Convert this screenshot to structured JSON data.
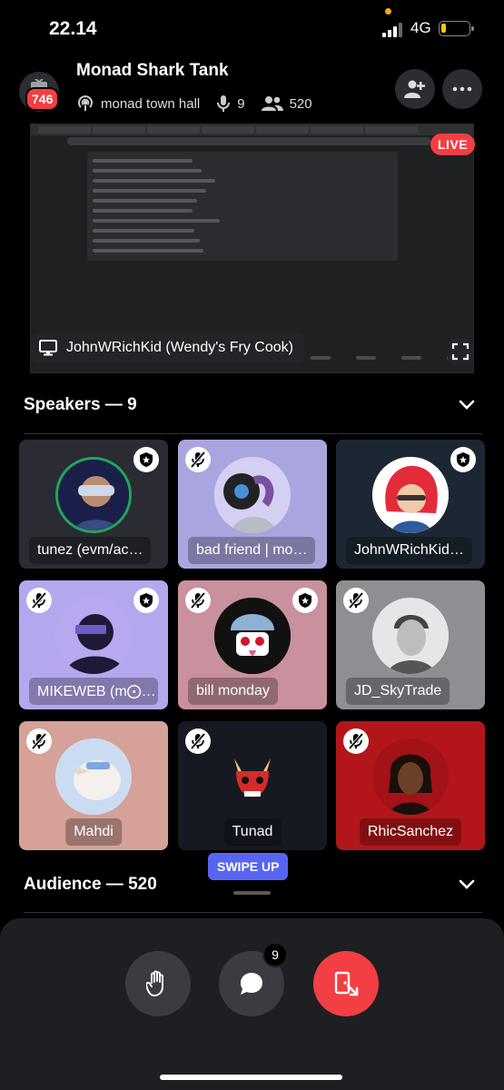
{
  "status_bar": {
    "time": "22.14",
    "network": "4G"
  },
  "header": {
    "badge_count": "746",
    "title": "Monad Shark Tank",
    "channel": "monad town hall",
    "speakers_count": "9",
    "listeners_count": "520"
  },
  "stream": {
    "live_label": "LIVE",
    "streamer_label": "JohnWRichKid (Wendy's Fry Cook)"
  },
  "speakers_section": {
    "label": "Speakers — 9"
  },
  "speakers": [
    {
      "name": "tunez (evm/ac…",
      "moderator": true,
      "muted": false
    },
    {
      "name": "bad friend | mo…",
      "moderator": false,
      "muted": true
    },
    {
      "name": "JohnWRichKid…",
      "moderator": true,
      "muted": false
    },
    {
      "name": "MIKEWEB (m⨀…",
      "moderator": true,
      "muted": true
    },
    {
      "name": "bill monday",
      "moderator": true,
      "muted": true
    },
    {
      "name": "JD_SkyTrade",
      "moderator": false,
      "muted": true
    },
    {
      "name": "Mahdi",
      "moderator": false,
      "muted": true
    },
    {
      "name": "Tunad",
      "moderator": false,
      "muted": true
    },
    {
      "name": "RhicSanchez",
      "moderator": false,
      "muted": true
    }
  ],
  "swipe_hint": "SWIPE UP",
  "audience_section": {
    "label": "Audience — 520"
  },
  "controls": {
    "chat_badge": "9"
  },
  "colors": {
    "accent": "#5865f2",
    "danger": "#f23f43"
  },
  "icons": [
    "tv-icon",
    "podcast-icon",
    "mic-icon",
    "users-icon",
    "add-user-icon",
    "more-icon",
    "monitor-icon",
    "fullscreen-icon",
    "chevron-down-icon",
    "shield-star-icon",
    "mic-off-icon",
    "hand-icon",
    "chat-bubble-icon",
    "leave-icon"
  ]
}
